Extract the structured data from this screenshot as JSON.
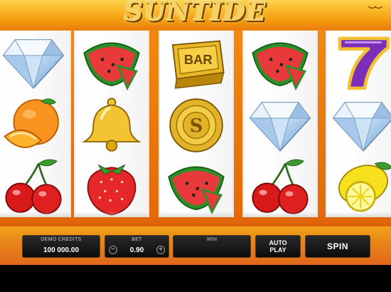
{
  "game": {
    "title": "SUNTIDE",
    "reels": [
      [
        "diamond",
        "orange",
        "cherries"
      ],
      [
        "watermelon",
        "bell",
        "strawberry"
      ],
      [
        "bar",
        "gold-coin",
        "watermelon"
      ],
      [
        "watermelon",
        "diamond",
        "cherries"
      ],
      [
        "seven",
        "diamond",
        "lemon"
      ]
    ]
  },
  "console": {
    "credits_label": "DEMO CREDITS",
    "credits_value": "100 000.00",
    "bet_label": "BET",
    "bet_value": "0.90",
    "bet_minus": "−",
    "bet_plus": "+",
    "win_label": "WIN",
    "win_value": "",
    "auto_play_label": "AUTO PLAY",
    "spin_label": "SPIN"
  },
  "symbols": {
    "bar_text": "BAR",
    "coin_text": "S",
    "seven_text": "7"
  }
}
